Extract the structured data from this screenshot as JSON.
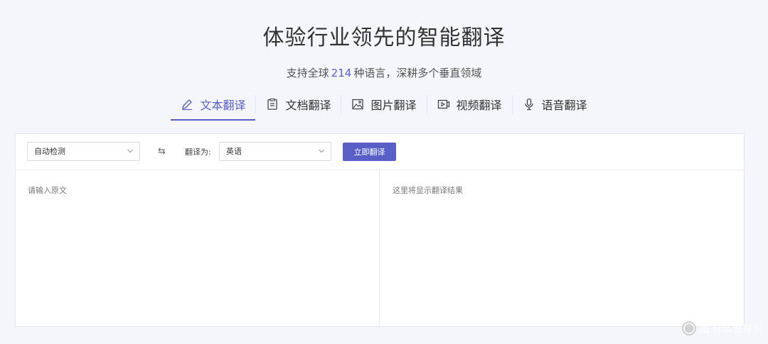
{
  "hero": {
    "title": "体验行业领先的智能翻译",
    "subtitle_prefix": "支持全球",
    "subtitle_count": "214",
    "subtitle_suffix": "种语言，深耕多个垂直领域"
  },
  "tabs": [
    {
      "label": "文本翻译",
      "icon": "pencil-icon",
      "active": true
    },
    {
      "label": "文档翻译",
      "icon": "document-icon",
      "active": false
    },
    {
      "label": "图片翻译",
      "icon": "image-icon",
      "active": false
    },
    {
      "label": "视频翻译",
      "icon": "video-icon",
      "active": false
    },
    {
      "label": "语音翻译",
      "icon": "microphone-icon",
      "active": false
    }
  ],
  "toolbar": {
    "source_lang": "自动检测",
    "swap_glyph": "⇆",
    "to_label": "翻译为:",
    "target_lang": "英语",
    "translate_button": "立即翻译"
  },
  "editor": {
    "input_placeholder": "请输入原文",
    "output_placeholder": "这里将显示翻译结果"
  },
  "watermark": {
    "text": "值 什么值得买"
  },
  "colors": {
    "accent": "#5a5fc8",
    "background": "#f4f6fb"
  }
}
